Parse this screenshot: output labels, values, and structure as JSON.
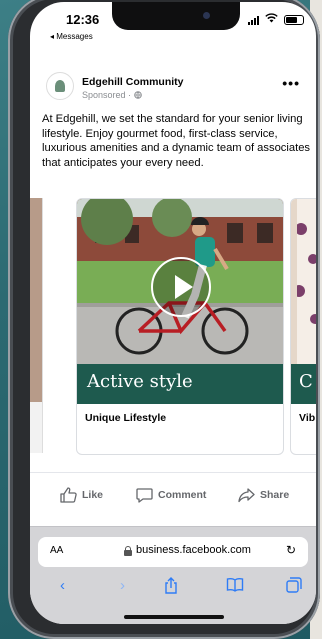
{
  "status_bar": {
    "time": "12:36",
    "back_app": "◂ Messages"
  },
  "post": {
    "page_name": "Edgehill Community",
    "sponsored": "Sponsored · ",
    "more": "•••",
    "text": "At Edgehill, we set the standard for your senior living lifestyle. Enjoy gourmet food, first-class service, luxurious amenities and a dynamic team of associates that anticipates your every need."
  },
  "carousel": {
    "cards": [
      {
        "band_text": "Active style",
        "caption": "Unique Lifestyle",
        "has_play_button": true
      },
      {
        "band_text": "C",
        "caption": "Vib"
      }
    ]
  },
  "actions": {
    "like": "Like",
    "comment": "Comment",
    "share": "Share"
  },
  "browser": {
    "text_size": "AA",
    "url": "business.facebook.com",
    "reload_icon": "↻"
  },
  "colors": {
    "band_green": "#1e5a4e",
    "background_teal": "#2c6a72",
    "link_blue": "#2e7cf6"
  }
}
